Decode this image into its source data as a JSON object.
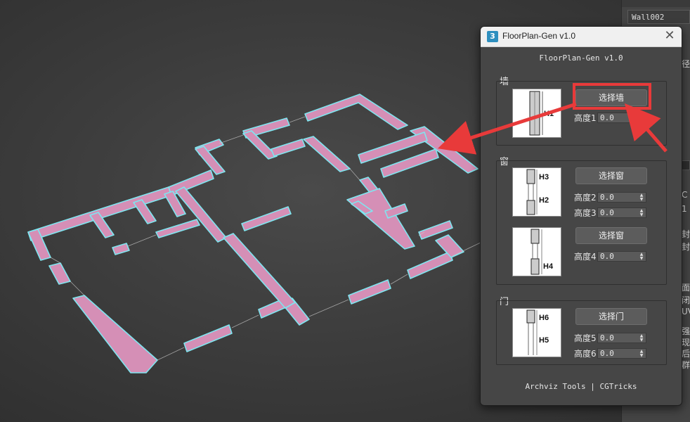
{
  "scene": {
    "object_name": "Wall002",
    "side_fragments": [
      "径",
      "C",
      "1",
      "封",
      "封",
      "面",
      "闭",
      "UV",
      "强",
      "现",
      "后",
      "群"
    ]
  },
  "dialog": {
    "window_title": "FloorPlan-Gen v1.0",
    "header": "FloorPlan-Gen v1.0",
    "close_glyph": "✕",
    "app_icon": "3",
    "footer": "Archviz Tools | CGTricks",
    "wall": {
      "label": "墙",
      "button": "选择墙",
      "height1_label": "高度1",
      "height1_value": "0.0",
      "tags": [
        "H1"
      ]
    },
    "window": {
      "label": "窗",
      "button_a": "选择窗",
      "height2_label": "高度2",
      "height2_value": "0.0",
      "height3_label": "高度3",
      "height3_value": "0.0",
      "tags_a": [
        "H3",
        "H2"
      ],
      "button_b": "选择窗",
      "height4_label": "高度4",
      "height4_value": "0.0",
      "tags_b": [
        "H4"
      ]
    },
    "door": {
      "label": "门",
      "button": "选择门",
      "height5_label": "高度5",
      "height5_value": "0.0",
      "height6_label": "高度6",
      "height6_value": "0.0",
      "tags": [
        "H6",
        "H5"
      ]
    }
  },
  "colors": {
    "wall_fill": "#d58fb6",
    "wall_outline": "#7fe6f0",
    "highlight": "#e83a3a",
    "dialog_bg": "#464646",
    "viewport_bg": "#3d3d3d"
  }
}
